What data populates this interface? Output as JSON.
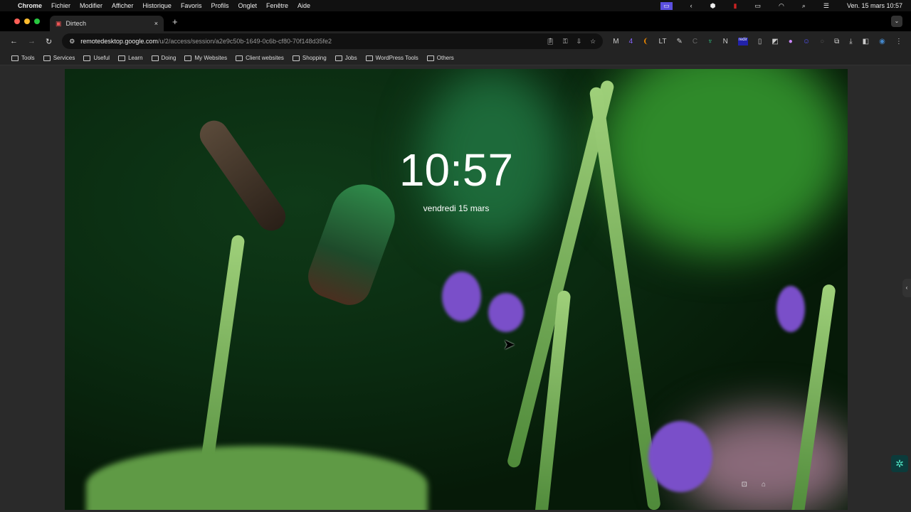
{
  "menubar": {
    "app": "Chrome",
    "items": [
      "Fichier",
      "Modifier",
      "Afficher",
      "Historique",
      "Favoris",
      "Profils",
      "Onglet",
      "Fenêtre",
      "Aide"
    ],
    "clock": "Ven. 15 mars  10:57"
  },
  "tab": {
    "title": "Dirtech"
  },
  "omnibox": {
    "host": "remotedesktop.google.com",
    "path": "/u/2/access/session/a2e9c50b-1649-0c6b-cf80-70f148d35fe2"
  },
  "extensions": {
    "redir_label": "redir",
    "badge": "4"
  },
  "bookmarks": [
    "Tools",
    "Services",
    "Useful",
    "Learn",
    "Doing",
    "My Websites",
    "Client websites",
    "Shopping",
    "Jobs",
    "WordPress Tools",
    "Others"
  ],
  "lockscreen": {
    "time": "10:57",
    "date": "vendredi 15 mars"
  }
}
